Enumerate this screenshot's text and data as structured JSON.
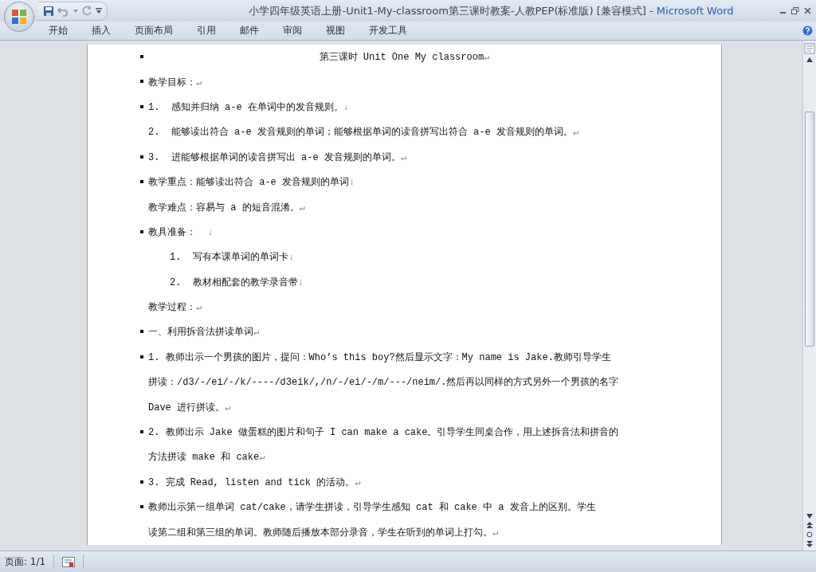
{
  "window": {
    "title": "小学四年级英语上册-Unit1-My-classroom第三课时教案-人教PEP(标准版) [兼容模式] -",
    "app_name": "Microsoft Word"
  },
  "ribbon_tabs": [
    {
      "label": "开始",
      "selected": false
    },
    {
      "label": "插入",
      "selected": false
    },
    {
      "label": "页面布局",
      "selected": false
    },
    {
      "label": "引用",
      "selected": false
    },
    {
      "label": "邮件",
      "selected": false
    },
    {
      "label": "审阅",
      "selected": false
    },
    {
      "label": "视图",
      "selected": false
    },
    {
      "label": "开发工具",
      "selected": false
    }
  ],
  "document": {
    "lines": [
      {
        "kind": "title",
        "marker": true,
        "text": "第三课时 Unit One My classroom",
        "end_mark": "↵"
      },
      {
        "kind": "body",
        "marker": true,
        "text": "教学目标：",
        "end_mark": "↵"
      },
      {
        "kind": "body",
        "marker": true,
        "text": "1.  感知并归纳 a-e 在单词中的发音规则。",
        "end_mark": "↓"
      },
      {
        "kind": "body",
        "marker": false,
        "text": "2.  能够读出符合 a-e 发音规则的单词；能够根据单词的读音拼写出符合 a-e 发音规则的单词。",
        "end_mark": "↵"
      },
      {
        "kind": "body",
        "marker": true,
        "text": "3.  进能够根据单词的读音拼写出 a-e 发音规则的单词。",
        "end_mark": "↵"
      },
      {
        "kind": "body",
        "marker": true,
        "text": "教学重点：能够读出符合 a-e 发音规则的单词",
        "end_mark": "↓"
      },
      {
        "kind": "body",
        "marker": false,
        "text": "教学难点：容易与 a 的短音混淆。",
        "end_mark": "↵"
      },
      {
        "kind": "body",
        "marker": true,
        "text": "教具准备：  ",
        "end_mark": "↓"
      },
      {
        "kind": "list",
        "marker": false,
        "text": "1.  写有本课单词的单词卡",
        "end_mark": "↓"
      },
      {
        "kind": "list",
        "marker": false,
        "text": "2.  教材相配套的教学录音带",
        "end_mark": "↓"
      },
      {
        "kind": "body",
        "marker": false,
        "text": "教学过程：",
        "end_mark": "↵"
      },
      {
        "kind": "body",
        "marker": true,
        "text": "一、利用拆音法拼读单词",
        "end_mark": "↵"
      },
      {
        "kind": "body",
        "marker": true,
        "text": "1. 教师出示一个男孩的图片，提问：Who’s this boy?然后显示文字：My name is Jake.教师引导学生"
      },
      {
        "kind": "body",
        "marker": false,
        "text": "拼读：/d3/-/ei/-/k/----/d3eik/,/n/-/ei/-/m/---/neim/.然后再以同样的方式另外一个男孩的名字"
      },
      {
        "kind": "body",
        "marker": false,
        "text": "Dave 进行拼读。",
        "end_mark": "↵"
      },
      {
        "kind": "body",
        "marker": true,
        "text": "2. 教师出示 Jake 做蛋糕的图片和句子 I can make a cake。引导学生同桌合作，用上述拆音法和拼音的"
      },
      {
        "kind": "body",
        "marker": false,
        "text": "方法拼读 make 和 cake",
        "end_mark": "↵"
      },
      {
        "kind": "body",
        "marker": true,
        "text": "3. 完成 Read, listen and tick 的活动。",
        "end_mark": "↵"
      },
      {
        "kind": "body",
        "marker": true,
        "text": "教师出示第一组单词 cat/cake，请学生拼读，引导学生感知 cat 和 cake 中 a 发音上的区别。学生"
      },
      {
        "kind": "body",
        "marker": false,
        "text": "读第二组和第三组的单词。教师随后播放本部分录音，学生在听到的单词上打勾。",
        "end_mark": "↵"
      }
    ]
  },
  "status_bar": {
    "page": "页面: 1/1"
  }
}
